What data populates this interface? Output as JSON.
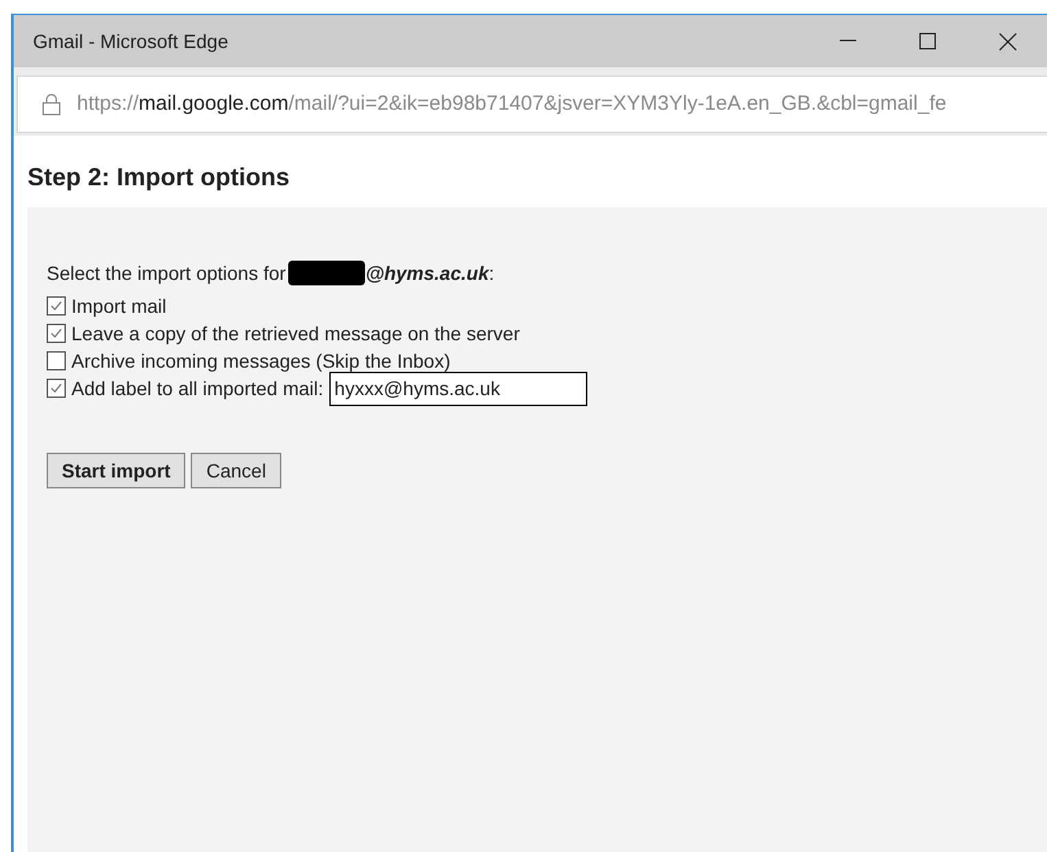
{
  "window": {
    "title": "Gmail - Microsoft Edge"
  },
  "address_bar": {
    "scheme": "https://",
    "host": "mail.google.com",
    "path": "/mail/?ui=2&ik=eb98b71407&jsver=XYM3Yly-1eA.en_GB.&cbl=gmail_fe"
  },
  "heading": "Step 2: Import options",
  "intro": {
    "text": "Select the import options for",
    "address": "@hyms.ac.uk",
    "suffix": ":"
  },
  "options": [
    {
      "label": "Import mail",
      "checked": true
    },
    {
      "label": "Leave a copy of the retrieved message on the server",
      "checked": true
    },
    {
      "label": "Archive incoming messages (Skip the Inbox)",
      "checked": false
    },
    {
      "label": "Add label to all imported mail:",
      "checked": true,
      "field_value": "hyxxx@hyms.ac.uk"
    }
  ],
  "buttons": [
    {
      "label": "Start import",
      "kind": "primary"
    },
    {
      "label": "Cancel",
      "kind": "secondary"
    }
  ]
}
